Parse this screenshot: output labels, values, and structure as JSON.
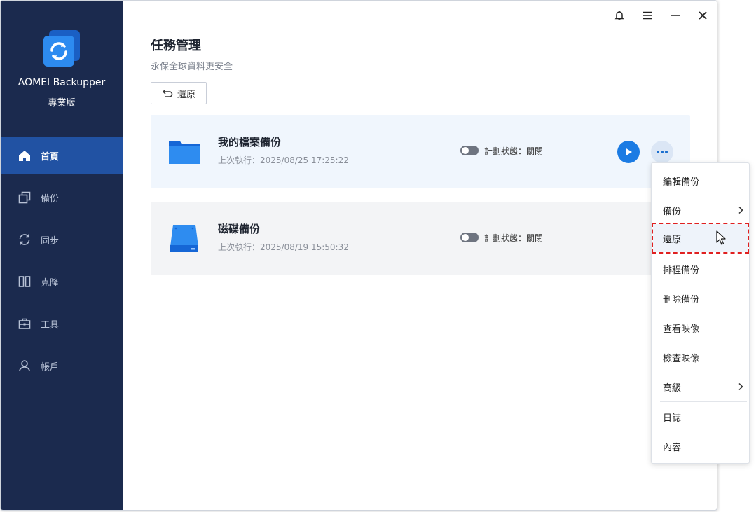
{
  "app": {
    "name": "AOMEI Backupper",
    "edition": "專業版",
    "logo_icon": "sync-logo-icon"
  },
  "sidebar": {
    "items": [
      {
        "label": "首頁",
        "icon": "home-icon",
        "active": true
      },
      {
        "label": "備份",
        "icon": "copy-icon",
        "active": false
      },
      {
        "label": "同步",
        "icon": "sync-icon",
        "active": false
      },
      {
        "label": "克隆",
        "icon": "clone-icon",
        "active": false
      },
      {
        "label": "工具",
        "icon": "toolbox-icon",
        "active": false
      },
      {
        "label": "帳戶",
        "icon": "user-icon",
        "active": false
      }
    ]
  },
  "titlebar": {
    "icons": [
      "bell-icon",
      "menu-icon",
      "minimize-icon",
      "close-icon"
    ]
  },
  "header": {
    "title": "任務管理",
    "subtitle": "永保全球資料更安全",
    "restore_label": "還原"
  },
  "tasks": [
    {
      "name": "我的檔案備份",
      "last_run": "上次執行：2025/08/25 17:25:22",
      "schedule": "計劃狀態：關閉",
      "icon": "folder-icon"
    },
    {
      "name": "磁碟備份",
      "last_run": "上次執行：2025/08/19 15:50:32",
      "schedule": "計劃狀態：關閉",
      "icon": "disk-icon"
    }
  ],
  "context_menu": {
    "items": [
      {
        "label": "編輯備份",
        "submenu": false
      },
      {
        "label": "備份",
        "submenu": true
      },
      {
        "label": "還原",
        "submenu": false,
        "highlighted": true
      },
      {
        "label": "排程備份",
        "submenu": false
      },
      {
        "label": "刪除備份",
        "submenu": false
      },
      {
        "label": "查看映像",
        "submenu": false
      },
      {
        "label": "檢查映像",
        "submenu": false
      },
      {
        "label": "高級",
        "submenu": true
      },
      {
        "label": "日誌",
        "submenu": false
      },
      {
        "label": "內容",
        "submenu": false
      }
    ]
  },
  "colors": {
    "sidebar_bg": "#1b2a4e",
    "active_nav": "#2152a3",
    "accent": "#1b7be3",
    "highlight_border": "#e02020"
  }
}
